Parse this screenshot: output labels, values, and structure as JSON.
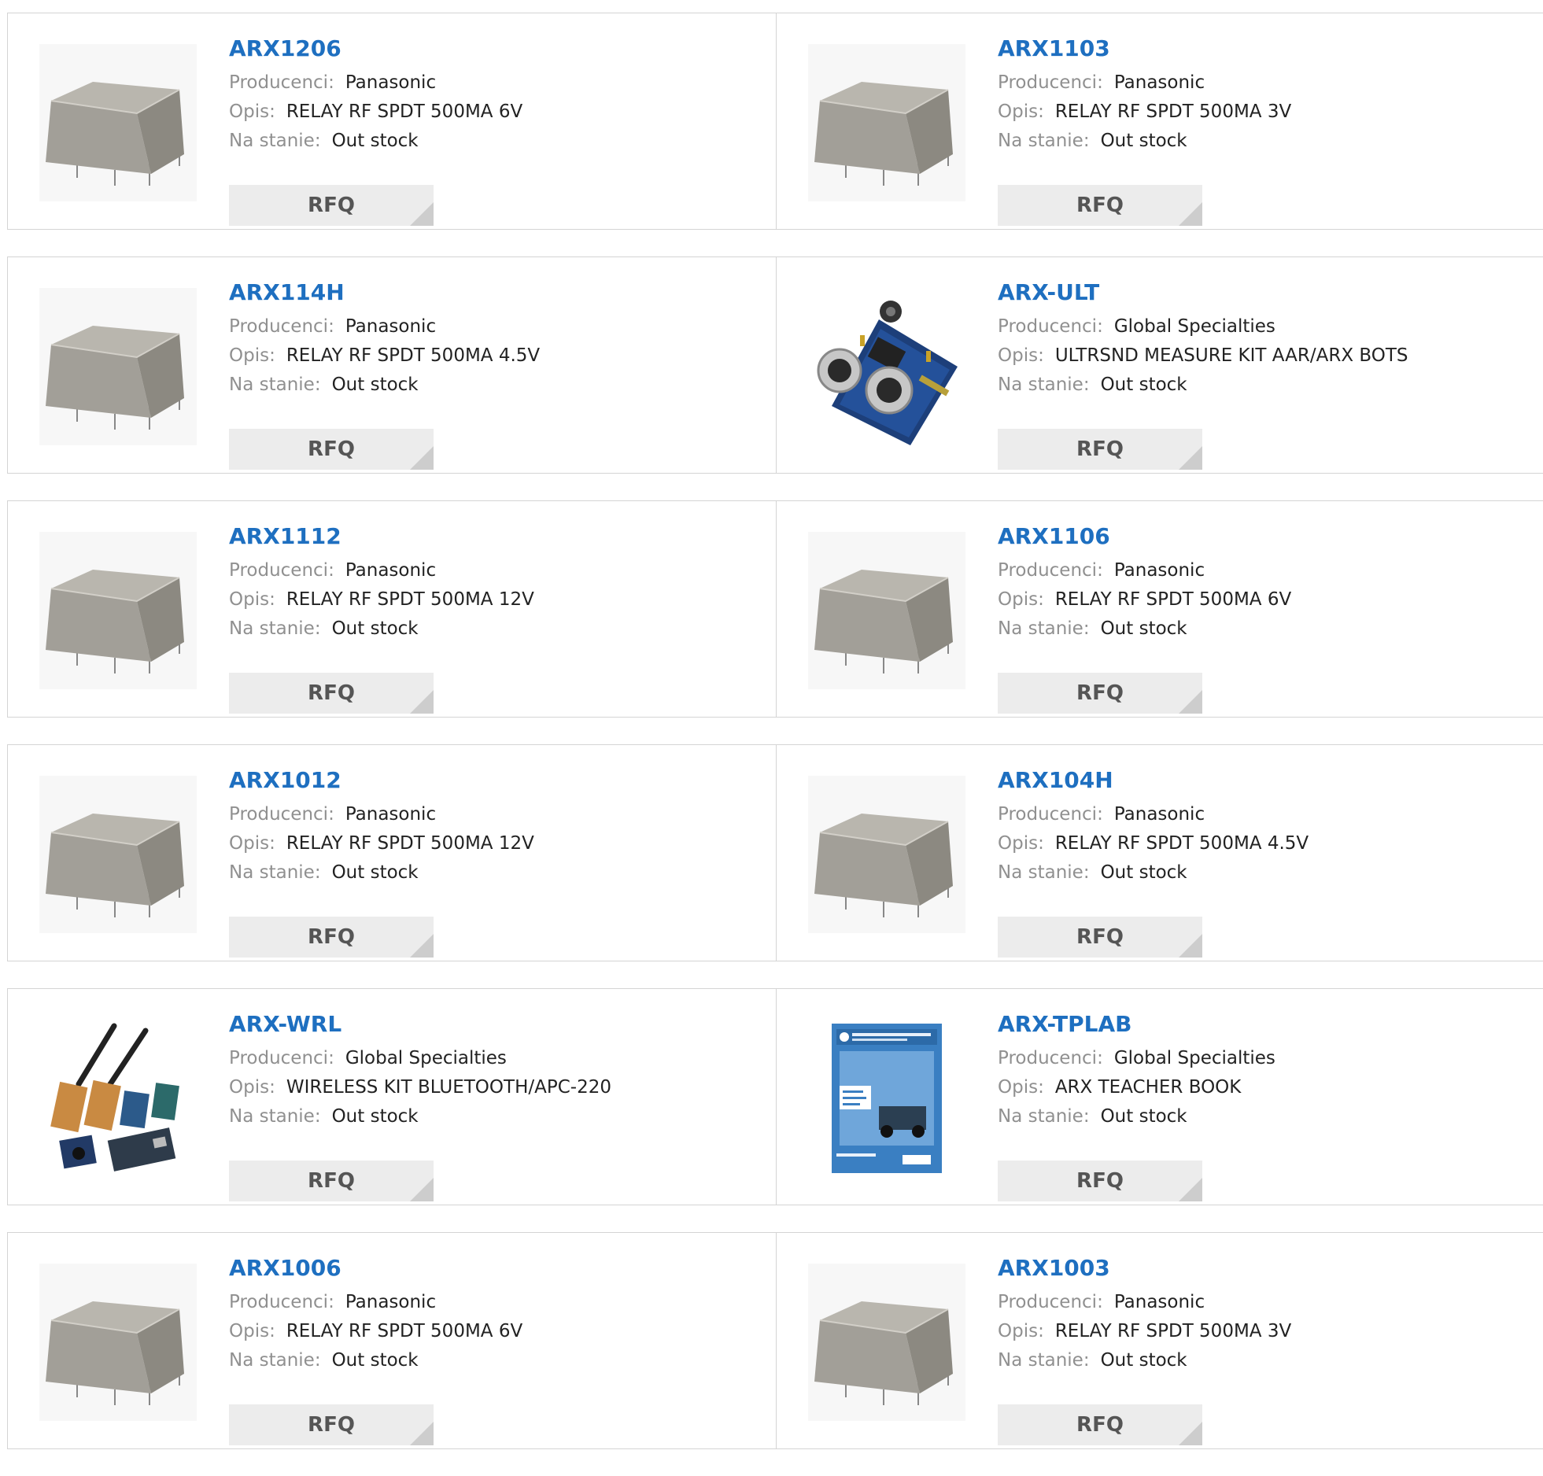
{
  "labels": {
    "manufacturer": "Producenci:",
    "description": "Opis:",
    "stock": "Na stanie:",
    "rfq": "RFQ"
  },
  "products": [
    {
      "name": "ARX1206",
      "manufacturer": "Panasonic",
      "description": "RELAY RF SPDT 500MA 6V",
      "stock": "Out stock",
      "image": "relay"
    },
    {
      "name": "ARX1103",
      "manufacturer": "Panasonic",
      "description": "RELAY RF SPDT 500MA 3V",
      "stock": "Out stock",
      "image": "relay"
    },
    {
      "name": "ARX114H",
      "manufacturer": "Panasonic",
      "description": "RELAY RF SPDT 500MA 4.5V",
      "stock": "Out stock",
      "image": "relay"
    },
    {
      "name": "ARX-ULT",
      "manufacturer": "Global Specialties",
      "description": "ULTRSND MEASURE KIT AAR/ARX BOTS",
      "stock": "Out stock",
      "image": "ultrasonic-board"
    },
    {
      "name": "ARX1112",
      "manufacturer": "Panasonic",
      "description": "RELAY RF SPDT 500MA 12V",
      "stock": "Out stock",
      "image": "relay"
    },
    {
      "name": "ARX1106",
      "manufacturer": "Panasonic",
      "description": "RELAY RF SPDT 500MA 6V",
      "stock": "Out stock",
      "image": "relay"
    },
    {
      "name": "ARX1012",
      "manufacturer": "Panasonic",
      "description": "RELAY RF SPDT 500MA 12V",
      "stock": "Out stock",
      "image": "relay"
    },
    {
      "name": "ARX104H",
      "manufacturer": "Panasonic",
      "description": "RELAY RF SPDT 500MA 4.5V",
      "stock": "Out stock",
      "image": "relay"
    },
    {
      "name": "ARX-WRL",
      "manufacturer": "Global Specialties",
      "description": "WIRELESS KIT BLUETOOTH/APC-220",
      "stock": "Out stock",
      "image": "wireless-kit"
    },
    {
      "name": "ARX-TPLAB",
      "manufacturer": "Global Specialties",
      "description": "ARX TEACHER BOOK",
      "stock": "Out stock",
      "image": "book"
    },
    {
      "name": "ARX1006",
      "manufacturer": "Panasonic",
      "description": "RELAY RF SPDT 500MA 6V",
      "stock": "Out stock",
      "image": "relay"
    },
    {
      "name": "ARX1003",
      "manufacturer": "Panasonic",
      "description": "RELAY RF SPDT 500MA 3V",
      "stock": "Out stock",
      "image": "relay"
    }
  ],
  "colors": {
    "link": "#1e6fc0",
    "label": "#909090",
    "value": "#222222",
    "button_bg": "#ececec",
    "button_text": "#555555",
    "border": "#d4d4d4"
  }
}
